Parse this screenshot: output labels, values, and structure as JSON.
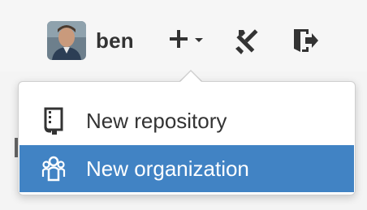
{
  "header": {
    "username": "ben",
    "create_menu_icon": "plus-dropdown-icon",
    "settings_icon": "tools-icon",
    "signout_icon": "sign-out-icon"
  },
  "dropdown": {
    "items": [
      {
        "label": "New repository",
        "icon": "repo-icon",
        "highlighted": false
      },
      {
        "label": "New organization",
        "icon": "organization-icon",
        "highlighted": true
      }
    ]
  },
  "colors": {
    "highlight": "#4183c4",
    "text": "#333333",
    "highlight_text": "#ffffff"
  }
}
